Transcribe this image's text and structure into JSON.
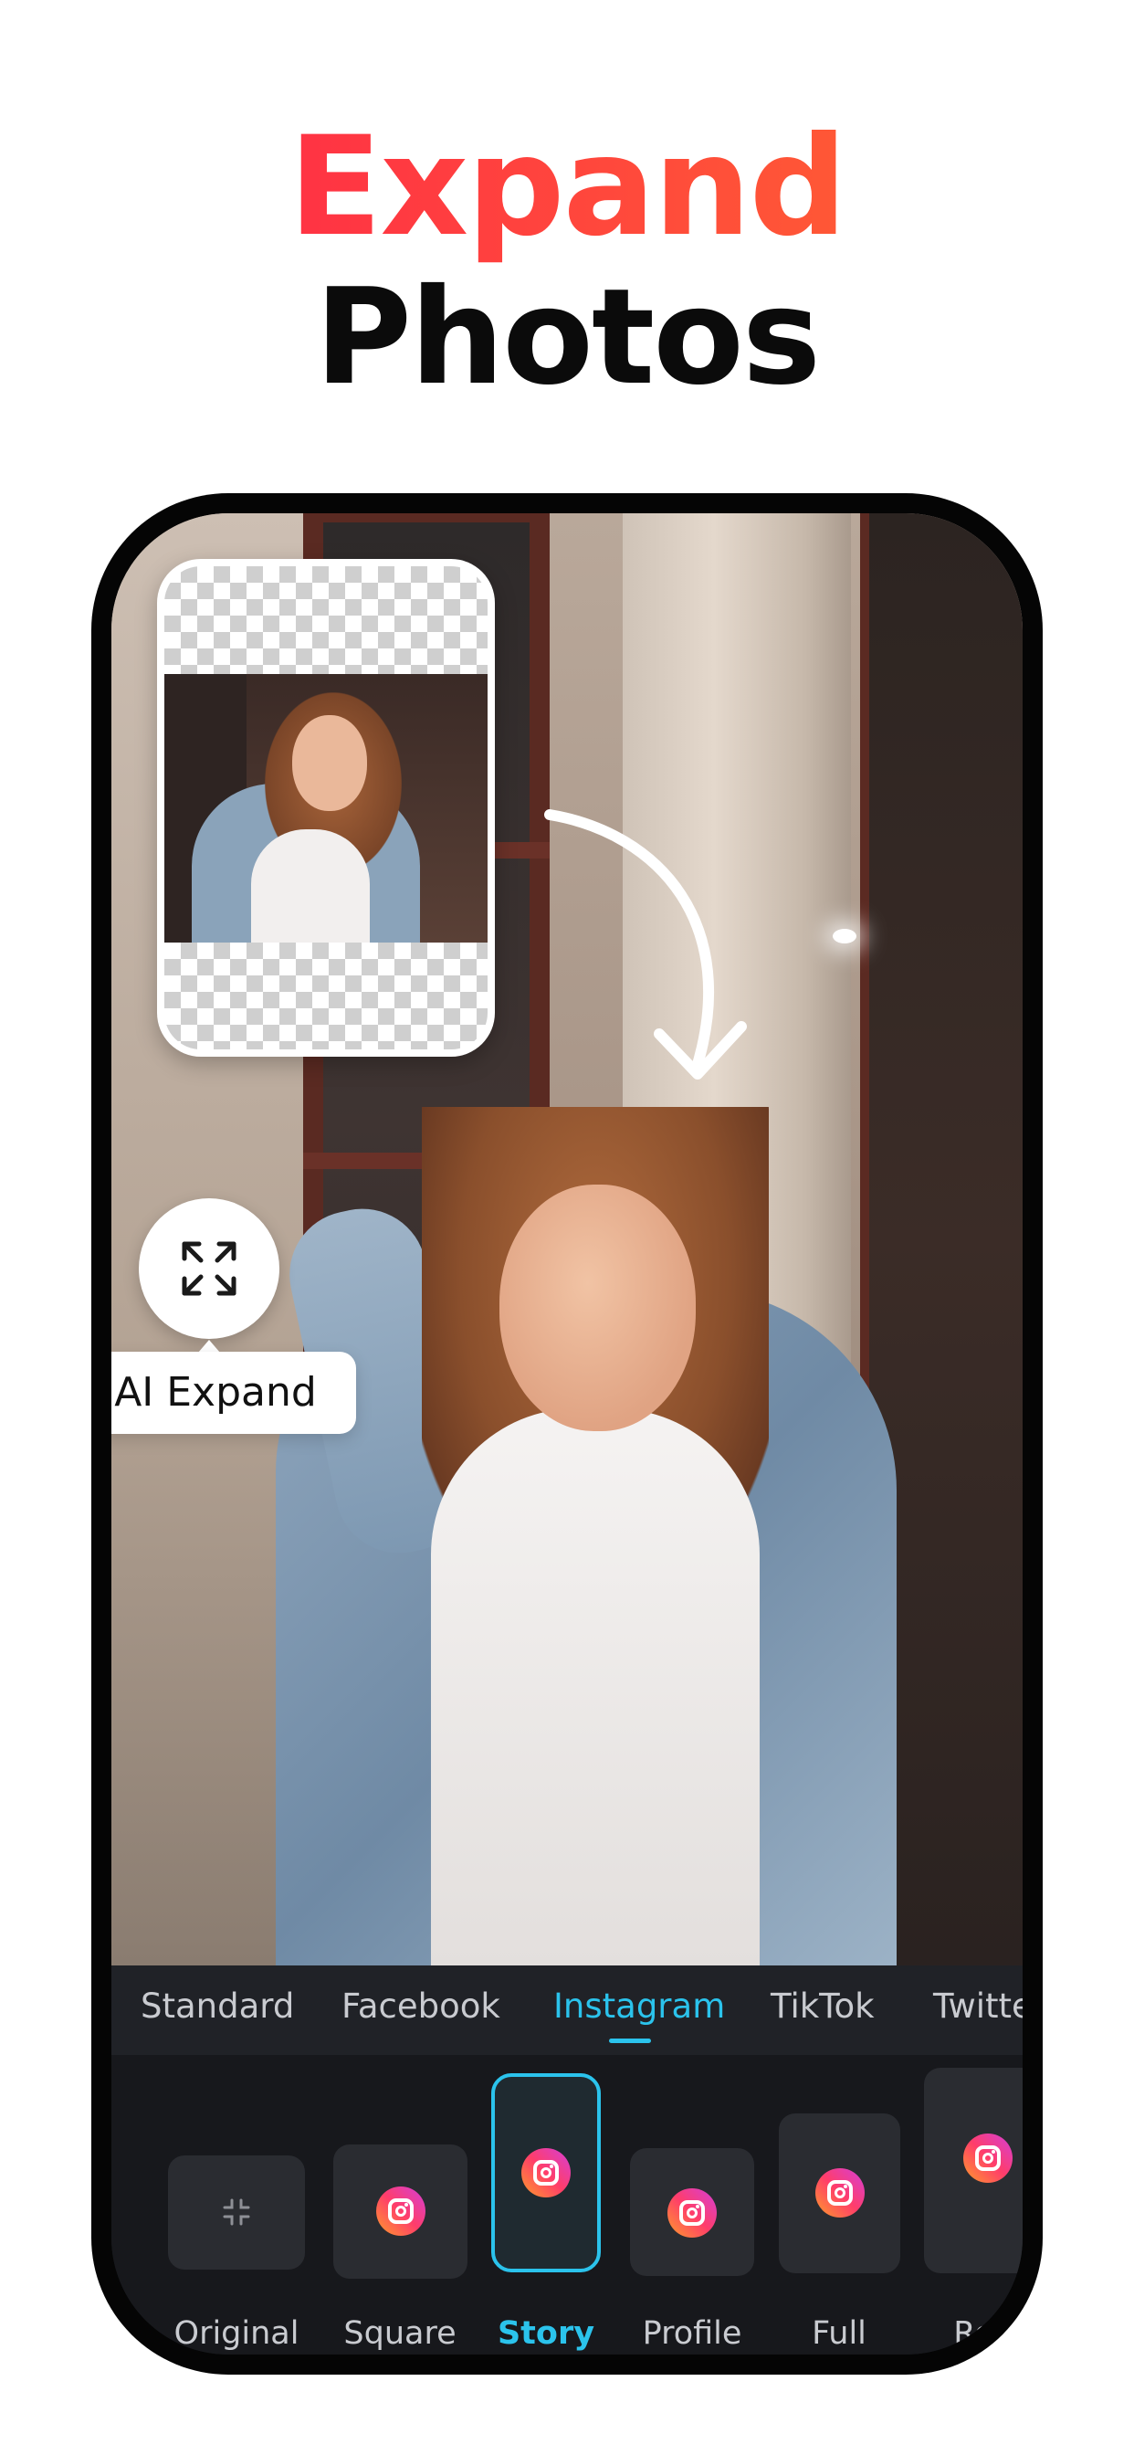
{
  "headline": {
    "line1": "Expand",
    "line2": "Photos"
  },
  "badge": {
    "label": "AI Expand",
    "icon": "expand-arrows-icon"
  },
  "tabs": [
    {
      "label": "Standard",
      "active": false
    },
    {
      "label": "Facebook",
      "active": false
    },
    {
      "label": "Instagram",
      "active": true
    },
    {
      "label": "TikTok",
      "active": false
    },
    {
      "label": "Twitter",
      "active": false
    }
  ],
  "sizes": [
    {
      "label": "Original",
      "icon": "shrink-icon",
      "active": false
    },
    {
      "label": "Square",
      "icon": "instagram-icon",
      "active": false
    },
    {
      "label": "Story",
      "icon": "instagram-icon",
      "active": true
    },
    {
      "label": "Profile",
      "icon": "instagram-icon",
      "active": false
    },
    {
      "label": "Full",
      "icon": "instagram-icon",
      "active": false
    },
    {
      "label": "Reel",
      "icon": "instagram-icon",
      "active": false
    }
  ],
  "colors": {
    "accent": "#2bc3ec",
    "headline_gradient_start": "#ff1f4b",
    "headline_gradient_end": "#ff6a2e"
  }
}
